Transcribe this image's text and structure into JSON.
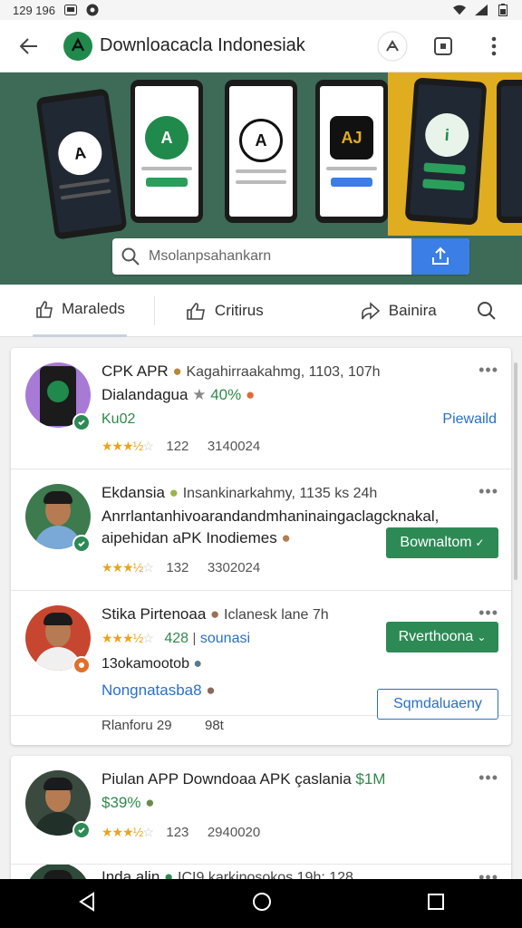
{
  "status": {
    "time": "129 196"
  },
  "appbar": {
    "title": "Downloacacla Indonesiak"
  },
  "hero": {
    "search_placeholder": "Msolanpsahankarn"
  },
  "tabs": [
    {
      "label": "Maraleds"
    },
    {
      "label": "Critirus"
    },
    {
      "label": "Bainira"
    }
  ],
  "items": [
    {
      "title": "CPK APR",
      "meta": "Kagahirraakahmg, 1103, 107h",
      "line2": "Dialandagua",
      "price": "40%",
      "sub": "Ku02",
      "rating": 3.5,
      "ratings_count": "122",
      "date": "3140024",
      "action": "Piewaild",
      "colors": {
        "avatar_bg": "#a77ad6",
        "badge": "#2e8a55"
      }
    },
    {
      "title": "Ekdansia",
      "meta": "Insankinarkahmy, 1135  ks 24h",
      "line2": "Anrrlantanhivoarandandmhaninaingaclagcknakal,",
      "line3": "aipehidan aPK Inodiemes",
      "rating": 3.5,
      "ratings_count": "132",
      "date": "3302024",
      "action": "Bownaltom",
      "colors": {
        "avatar_bg": "#3d7a4e",
        "badge": "#2e8a55"
      }
    },
    {
      "title": "Stika Pirtenoaa",
      "meta": "Iclanesk lane 7h",
      "price": "428",
      "price_sub": "sounasi",
      "sub": "13okamootob",
      "link": "Nongnatasba8",
      "foot_a": "Rlanforu 29",
      "foot_b": "98t",
      "rating": 3.5,
      "action": "Rverthoona",
      "action2": "Sqmdaluaeny",
      "colors": {
        "avatar_bg": "#c7462f",
        "badge": "#e0702a"
      }
    },
    {
      "title": "Piulan APP Downdoaa APK çaslania",
      "price": "$1M",
      "price2": "$39%",
      "rating": 3.5,
      "ratings_count": "123",
      "date": "2940020",
      "colors": {
        "avatar_bg": "#3a4a3f",
        "badge": "#2e8a55"
      }
    },
    {
      "title": "Inda alin",
      "meta": "ICI9 karkinosokos 19h:  128",
      "colors": {
        "avatar_bg": "#2d4a3a",
        "badge": "#2e8a55"
      }
    }
  ]
}
